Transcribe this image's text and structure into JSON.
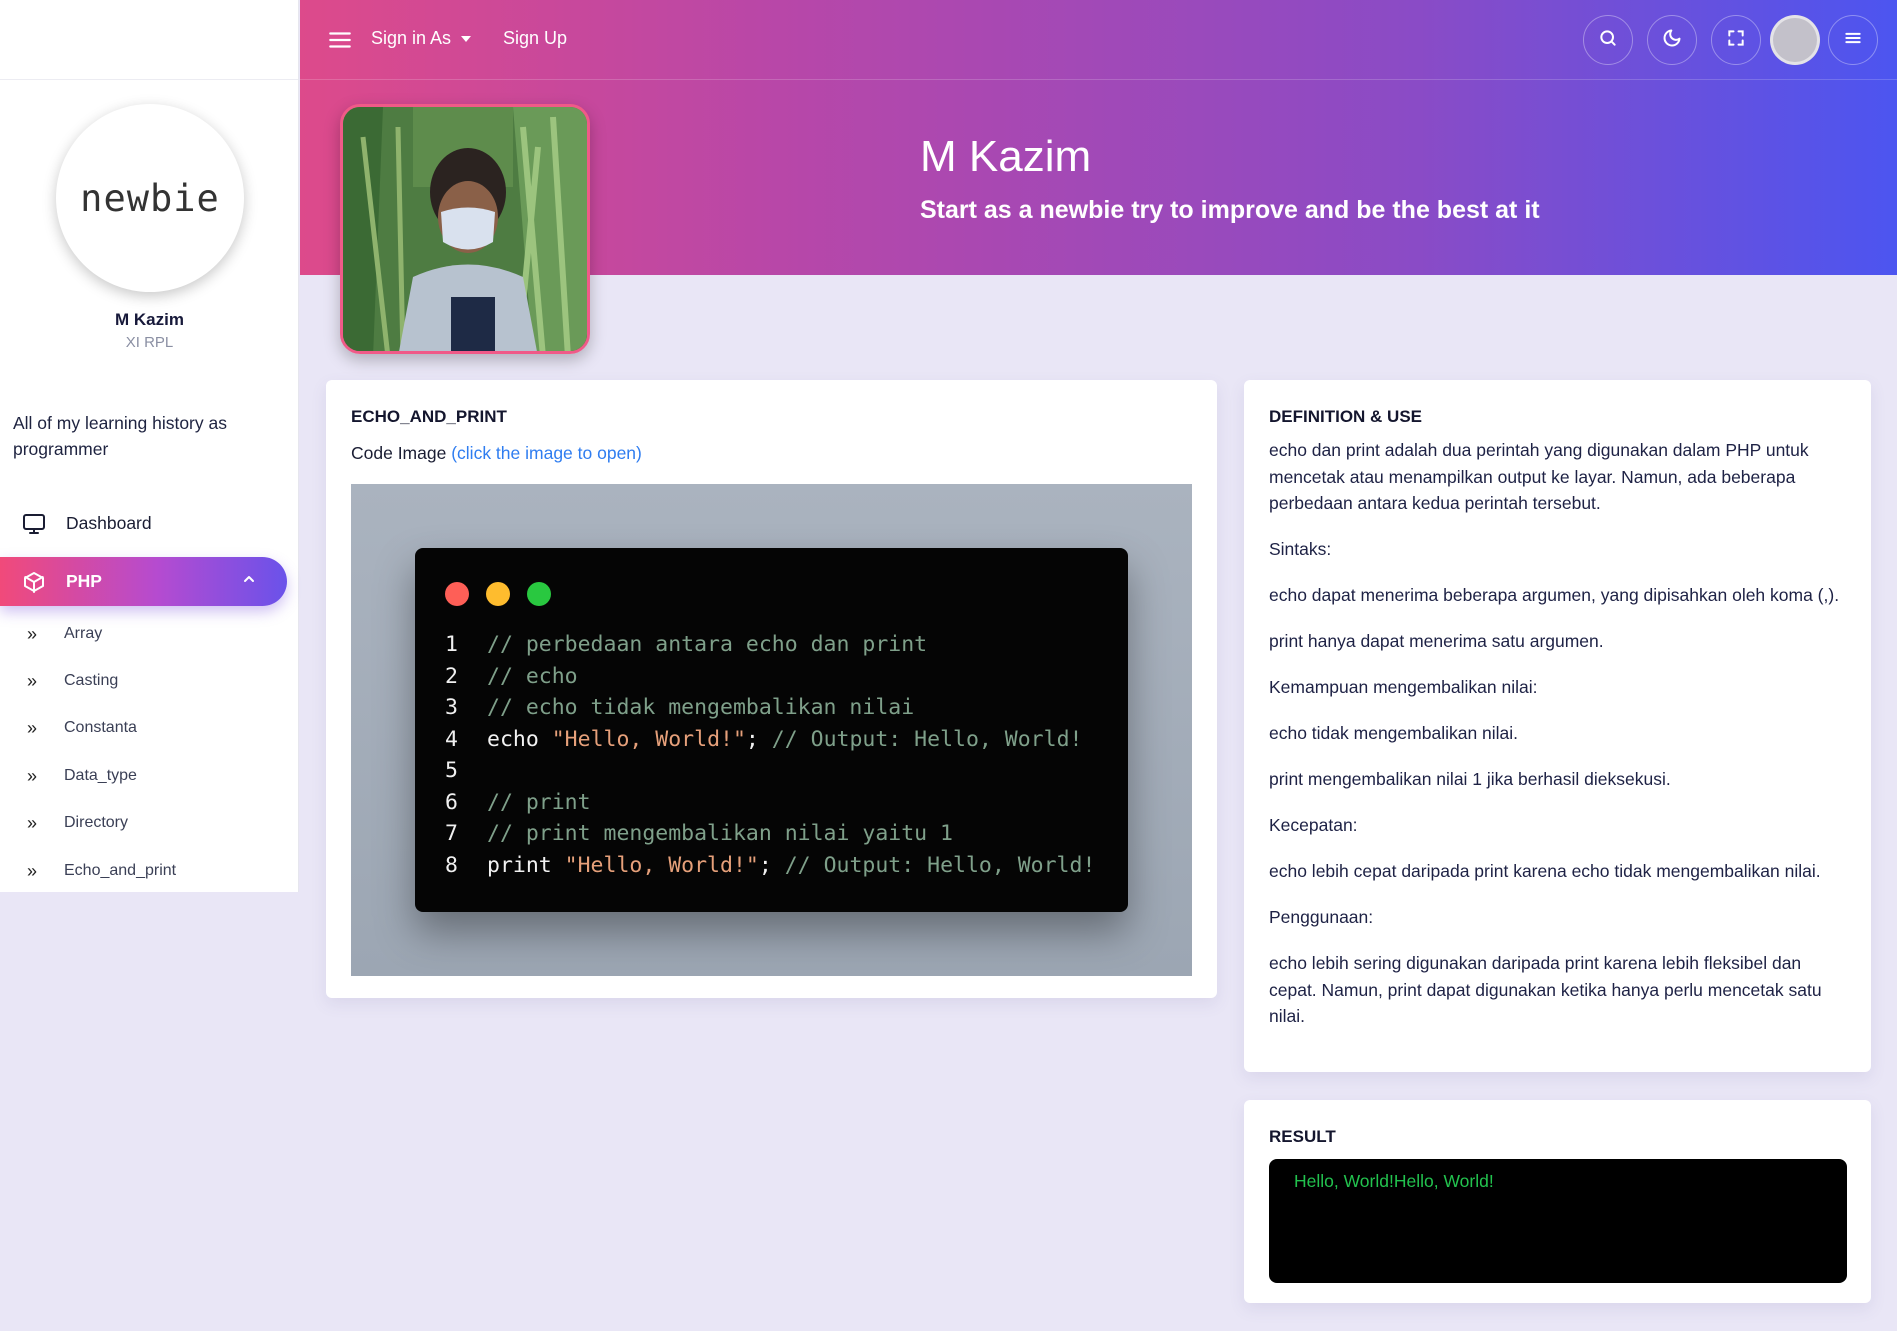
{
  "sidebar": {
    "logo_text": "newbie",
    "profile_name": "M Kazim",
    "profile_class": "XI RPL",
    "description": "All of my learning history as programmer",
    "nav": {
      "dashboard": "Dashboard",
      "php": "PHP"
    },
    "sub_items": [
      "Array",
      "Casting",
      "Constanta",
      "Data_type",
      "Directory",
      "Echo_and_print"
    ]
  },
  "header": {
    "sign_in": "Sign in As",
    "sign_up": "Sign Up",
    "name": "M Kazim",
    "tagline": "Start as a newbie try to improve and be the best at it"
  },
  "echo_card": {
    "title": "ECHO_AND_PRINT",
    "code_image_label": "Code Image",
    "code_image_link": "(click the image to open)",
    "code": [
      {
        "n": "1",
        "parts": [
          {
            "c": "cm",
            "t": "// perbedaan antara echo dan print"
          }
        ]
      },
      {
        "n": "2",
        "parts": [
          {
            "c": "cm",
            "t": "// echo"
          }
        ]
      },
      {
        "n": "3",
        "parts": [
          {
            "c": "cm",
            "t": "// echo tidak mengembalikan nilai"
          }
        ]
      },
      {
        "n": "4",
        "parts": [
          {
            "c": "kw",
            "t": "echo "
          },
          {
            "c": "st",
            "t": "\"Hello, World!\""
          },
          {
            "c": "kw",
            "t": "; "
          },
          {
            "c": "cm",
            "t": "// Output: Hello, World!"
          }
        ]
      },
      {
        "n": "5",
        "parts": []
      },
      {
        "n": "6",
        "parts": [
          {
            "c": "cm",
            "t": "// print"
          }
        ]
      },
      {
        "n": "7",
        "parts": [
          {
            "c": "cm",
            "t": "// print mengembalikan nilai yaitu 1"
          }
        ]
      },
      {
        "n": "8",
        "parts": [
          {
            "c": "kw",
            "t": "print "
          },
          {
            "c": "st",
            "t": "\"Hello, World!\""
          },
          {
            "c": "kw",
            "t": "; "
          },
          {
            "c": "cm",
            "t": "// Output: Hello, World!"
          }
        ]
      }
    ]
  },
  "definition_card": {
    "title": "DEFINITION & USE",
    "paragraphs": [
      "echo dan print adalah dua perintah yang digunakan dalam PHP untuk mencetak atau menampilkan output ke layar. Namun, ada beberapa perbedaan antara kedua perintah tersebut.",
      "Sintaks:",
      "echo dapat menerima beberapa argumen, yang dipisahkan oleh koma (,).",
      "print hanya dapat menerima satu argumen.",
      "Kemampuan mengembalikan nilai:",
      "echo tidak mengembalikan nilai.",
      "print mengembalikan nilai 1 jika berhasil dieksekusi.",
      "Kecepatan:",
      "echo lebih cepat daripada print karena echo tidak mengembalikan nilai.",
      "Penggunaan:",
      "echo lebih sering digunakan daripada print karena lebih fleksibel dan cepat. Namun, print dapat digunakan ketika hanya perlu mencetak satu nilai."
    ]
  },
  "result_card": {
    "title": "RESULT",
    "output": "Hello, World!Hello, World!"
  },
  "colors": {
    "accent_pink": "#f14a7a",
    "accent_purple": "#8a4bc6",
    "accent_blue": "#4c55f0",
    "link": "#2f7df0",
    "result_text": "#22c24e"
  },
  "icons": {
    "hamburger": "menu-icon",
    "search": "search-icon",
    "theme": "moon-icon",
    "fullscreen": "fullscreen-icon",
    "menu": "menu-icon",
    "dashboard": "monitor-icon",
    "php": "cube-icon",
    "collapse": "chevron-up-icon",
    "sub": "double-chevron-right-icon"
  }
}
